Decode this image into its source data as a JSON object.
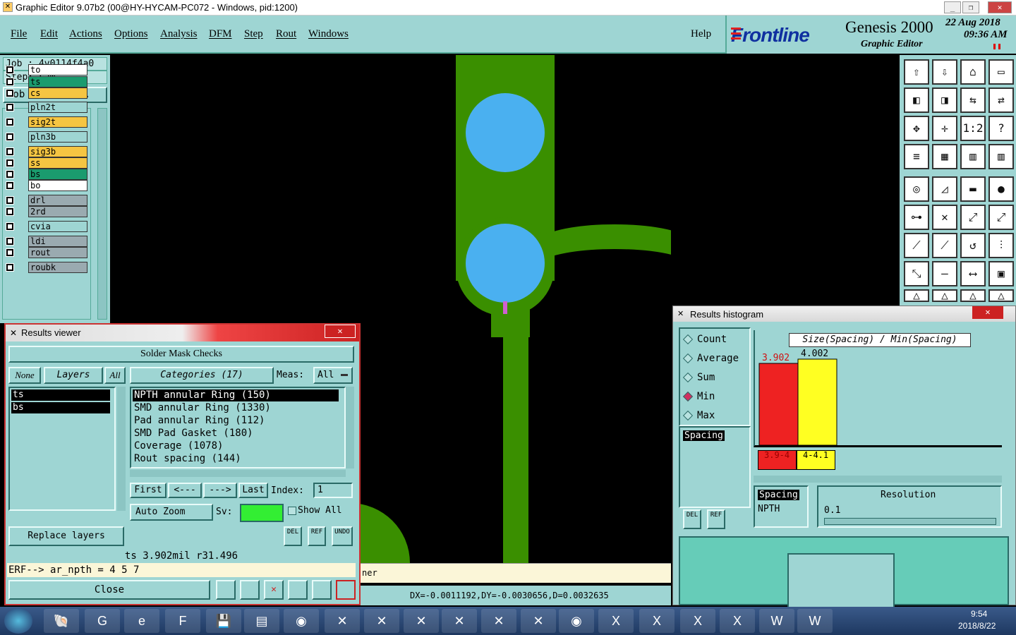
{
  "window": {
    "title": "Graphic Editor 9.07b2 (00@HY-HYCAM-PC072 - Windows, pid:1200)"
  },
  "menu": [
    "File",
    "Edit",
    "Actions",
    "Options",
    "Analysis",
    "DFM",
    "Step",
    "Rout",
    "Windows"
  ],
  "help": "Help",
  "brand": {
    "logo": "Frontline",
    "product": "Genesis 2000",
    "subtitle": "Graphic Editor",
    "date": "22 Aug 2018",
    "time": "09:36 AM"
  },
  "job": {
    "job_label": "Job : 4v0114f4a0",
    "step_label": "Step: cam",
    "matrix_button": "Job Matrix ..."
  },
  "layers": [
    {
      "name": "to",
      "color": "#ffffff"
    },
    {
      "name": "ts",
      "color": "#1a9b6e"
    },
    {
      "name": "cs",
      "color": "#f5c542"
    },
    {
      "name": "pln2t",
      "color": "#9ed5d3"
    },
    {
      "name": "sig2t",
      "color": "#f5c542"
    },
    {
      "name": "pln3b",
      "color": "#9ed5d3"
    },
    {
      "name": "sig3b",
      "color": "#f5c542"
    },
    {
      "name": "ss",
      "color": "#f5c542"
    },
    {
      "name": "bs",
      "color": "#1a9b6e"
    },
    {
      "name": "bo",
      "color": "#ffffff"
    },
    {
      "name": "drl",
      "color": "#9aaab0"
    },
    {
      "name": "2rd",
      "color": "#9aaab0"
    },
    {
      "name": "cvia",
      "color": "#9ed5d3"
    },
    {
      "name": "ldi",
      "color": "#9aaab0"
    },
    {
      "name": "rout",
      "color": "#9aaab0"
    },
    {
      "name": "roubk",
      "color": "#9aaab0"
    }
  ],
  "results": {
    "title": "Results viewer",
    "heading": "Solder Mask Checks",
    "none": "None",
    "layers_btn": "Layers",
    "all": "All",
    "categories": "Categories (17)",
    "meas_label": "Meas:",
    "meas_value": "All",
    "layer_list": [
      "ts",
      "bs"
    ],
    "category_list": [
      "NPTH annular Ring (150)",
      "SMD annular Ring (1330)",
      "Pad annular Ring (112)",
      "SMD Pad Gasket (180)",
      "Coverage (1078)",
      "Rout spacing (144)"
    ],
    "first": "First",
    "prev": "<---",
    "next": "--->",
    "last": "Last",
    "index_label": "Index:",
    "index_value": "1",
    "autozoom": "Auto Zoom",
    "sv_label": "Sv:",
    "show_all": "Show All",
    "replace": "Replace layers",
    "del": "DEL",
    "ref": "REF",
    "undo": "UNDO",
    "status": "ts 3.902mil  r31.496",
    "erf": "ERF--> ar_npth = 4 5 7",
    "close": "Close"
  },
  "histogram": {
    "title": "Results histogram",
    "options": [
      "Count",
      "Average",
      "Sum",
      "Min",
      "Max"
    ],
    "selected": "Min",
    "chart_title": "Size(Spacing) / Min(Spacing)",
    "list_item": "Spacing",
    "side_labels": [
      "Spacing",
      "NPTH"
    ],
    "resolution_label": "Resolution",
    "resolution_value": "0.1",
    "del": "DEL",
    "ref": "REF"
  },
  "chart_data": {
    "type": "bar",
    "title": "Size(Spacing) / Min(Spacing)",
    "categories": [
      "3.9-4",
      "4-4.1"
    ],
    "values": [
      3.902,
      4.002
    ],
    "colors": [
      "#ee2222",
      "#ffff22"
    ]
  },
  "status_partial": "ner",
  "dxline": "DX=-0.0011192,DY=-0.0030656,D=0.0032635",
  "clock": {
    "time": "9:54",
    "date": "2018/8/22"
  }
}
